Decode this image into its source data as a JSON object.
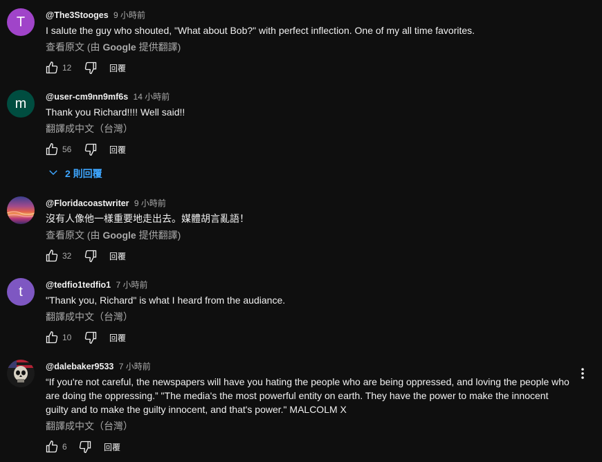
{
  "comments": [
    {
      "author": "@The3Stooges",
      "time": "9 小時前",
      "avatar_letter": "T",
      "avatar_color": "#a044c9",
      "text": "I salute the guy who shouted, \"What about Bob?\" with perfect inflection. One of my all time favorites.",
      "translate_prefix": "查看原文 (由 ",
      "translate_brand": "Google",
      "translate_suffix": " 提供翻譯)",
      "likes": "12",
      "reply_label": "回覆"
    },
    {
      "author": "@user-cm9nn9mf6s",
      "time": "14 小時前",
      "avatar_letter": "m",
      "avatar_color": "#004d40",
      "text": "Thank you Richard!!!! Well said!!",
      "translate_label": "翻譯成中文（台灣）",
      "likes": "56",
      "reply_label": "回覆",
      "replies_toggle": "2 則回覆"
    },
    {
      "author": "@Floridacoastwriter",
      "time": "9 小時前",
      "text": "沒有人像他一樣重要地走出去。媒體胡言亂語！",
      "translate_prefix": "查看原文 (由 ",
      "translate_brand": "Google",
      "translate_suffix": " 提供翻譯)",
      "likes": "32",
      "reply_label": "回覆"
    },
    {
      "author": "@tedfio1tedfio1",
      "time": "7 小時前",
      "avatar_letter": "t",
      "avatar_color": "#7e57c2",
      "text": "\"Thank you, Richard\" is what I heard from the audiance.",
      "translate_label": "翻譯成中文（台灣）",
      "likes": "10",
      "reply_label": "回覆"
    },
    {
      "author": "@dalebaker9533",
      "time": "7 小時前",
      "text": "“If you're not careful, the newspapers will have you hating the people who are being oppressed, and loving the people who are doing the oppressing.” \"The media's the most powerful entity on earth. They have the power to make the innocent guilty and to make the guilty innocent, and that's power.\" MALCOLM X",
      "translate_label": "翻譯成中文（台灣）",
      "likes": "6",
      "reply_label": "回覆"
    }
  ],
  "icons": {
    "like": "thumb-up-icon",
    "dislike": "thumb-down-icon",
    "menu": "more-vert-icon",
    "expand": "chevron-down-icon"
  }
}
